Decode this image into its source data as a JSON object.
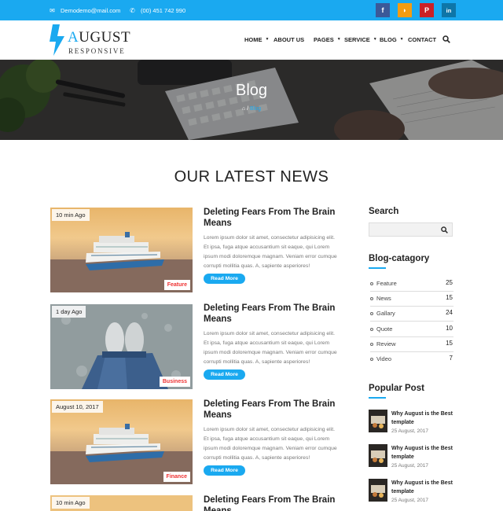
{
  "topbar": {
    "email": "Demodemo@mail.com",
    "phone": "(00) 451 742 990",
    "social": [
      {
        "icon": "facebook-icon",
        "label": "f",
        "color": "#3b5998"
      },
      {
        "icon": "rss-icon",
        "label": "◗",
        "color": "#f39c12"
      },
      {
        "icon": "pinterest-icon",
        "label": "P",
        "color": "#cb2027"
      },
      {
        "icon": "linkedin-icon",
        "label": "in",
        "color": "#0e76a8"
      }
    ]
  },
  "logo": {
    "first": "A",
    "rest": "UGUST",
    "sub": "RESPONSIVE"
  },
  "nav": [
    {
      "label": "HOME",
      "dropdown": true
    },
    {
      "label": "ABOUT US",
      "dropdown": false
    },
    {
      "label": "PAGES",
      "dropdown": true
    },
    {
      "label": "SERVICE",
      "dropdown": true
    },
    {
      "label": "BLOG",
      "dropdown": true
    },
    {
      "label": "CONTACT",
      "dropdown": false
    }
  ],
  "hero": {
    "title": "Blog",
    "breadcrumb_sep": "/",
    "breadcrumb_current": "Blog"
  },
  "section_title": "OUR LATEST NEWS",
  "posts": [
    {
      "time": "10 min Ago",
      "category": "Feature",
      "image": "cruise-ship",
      "title": "Deleting Fears From The Brain Means",
      "text": "Lorem ipsum dolor sit amet, consectetur adipisicing elit. Et ipsa, fuga atque accusantium sit eaque, qui Lorem ipsum modi doloremque magnam. Veniam error cumque corrupti mollitia quas. A, sapiente asperiores!",
      "button": "Read More"
    },
    {
      "time": "1 day Ago",
      "category": "Business",
      "image": "shoes-on-ground",
      "title": "Deleting Fears From The Brain Means",
      "text": "Lorem ipsum dolor sit amet, consectetur adipisicing elit. Et ipsa, fuga atque accusantium sit eaque, qui Lorem ipsum modi doloremque magnam. Veniam error cumque corrupti mollitia quas. A, sapiente asperiores!",
      "button": "Read More"
    },
    {
      "time": "August 10, 2017",
      "category": "Finance",
      "image": "cruise-ship",
      "title": "Deleting Fears From The Brain Means",
      "text": "Lorem ipsum dolor sit amet, consectetur adipisicing elit. Et ipsa, fuga atque accusantium sit eaque, qui Lorem ipsum modi doloremque magnam. Veniam error cumque corrupti mollitia quas. A, sapiente asperiores!",
      "button": "Read More"
    },
    {
      "time": "10 min Ago",
      "category": "",
      "image": "cruise-ship",
      "title": "Deleting Fears From The Brain Means",
      "text": "",
      "button": ""
    }
  ],
  "sidebar": {
    "search_title": "Search",
    "search_placeholder": "",
    "category_title": "Blog-catagory",
    "categories": [
      {
        "label": "Feature",
        "count": "25"
      },
      {
        "label": "News",
        "count": "15"
      },
      {
        "label": "Gallary",
        "count": "24"
      },
      {
        "label": "Quote",
        "count": "10"
      },
      {
        "label": "Review",
        "count": "15"
      },
      {
        "label": "Video",
        "count": "7"
      }
    ],
    "popular_title": "Popular Post",
    "popular": [
      {
        "title": "Why August is the Best template",
        "date": "25 August, 2017"
      },
      {
        "title": "Why August is the Best template",
        "date": "25 August, 2017"
      },
      {
        "title": "Why August is the Best template",
        "date": "25 August, 2017"
      }
    ]
  },
  "colors": {
    "accent": "#1aa9f0",
    "badge_text": "#ee3333"
  }
}
